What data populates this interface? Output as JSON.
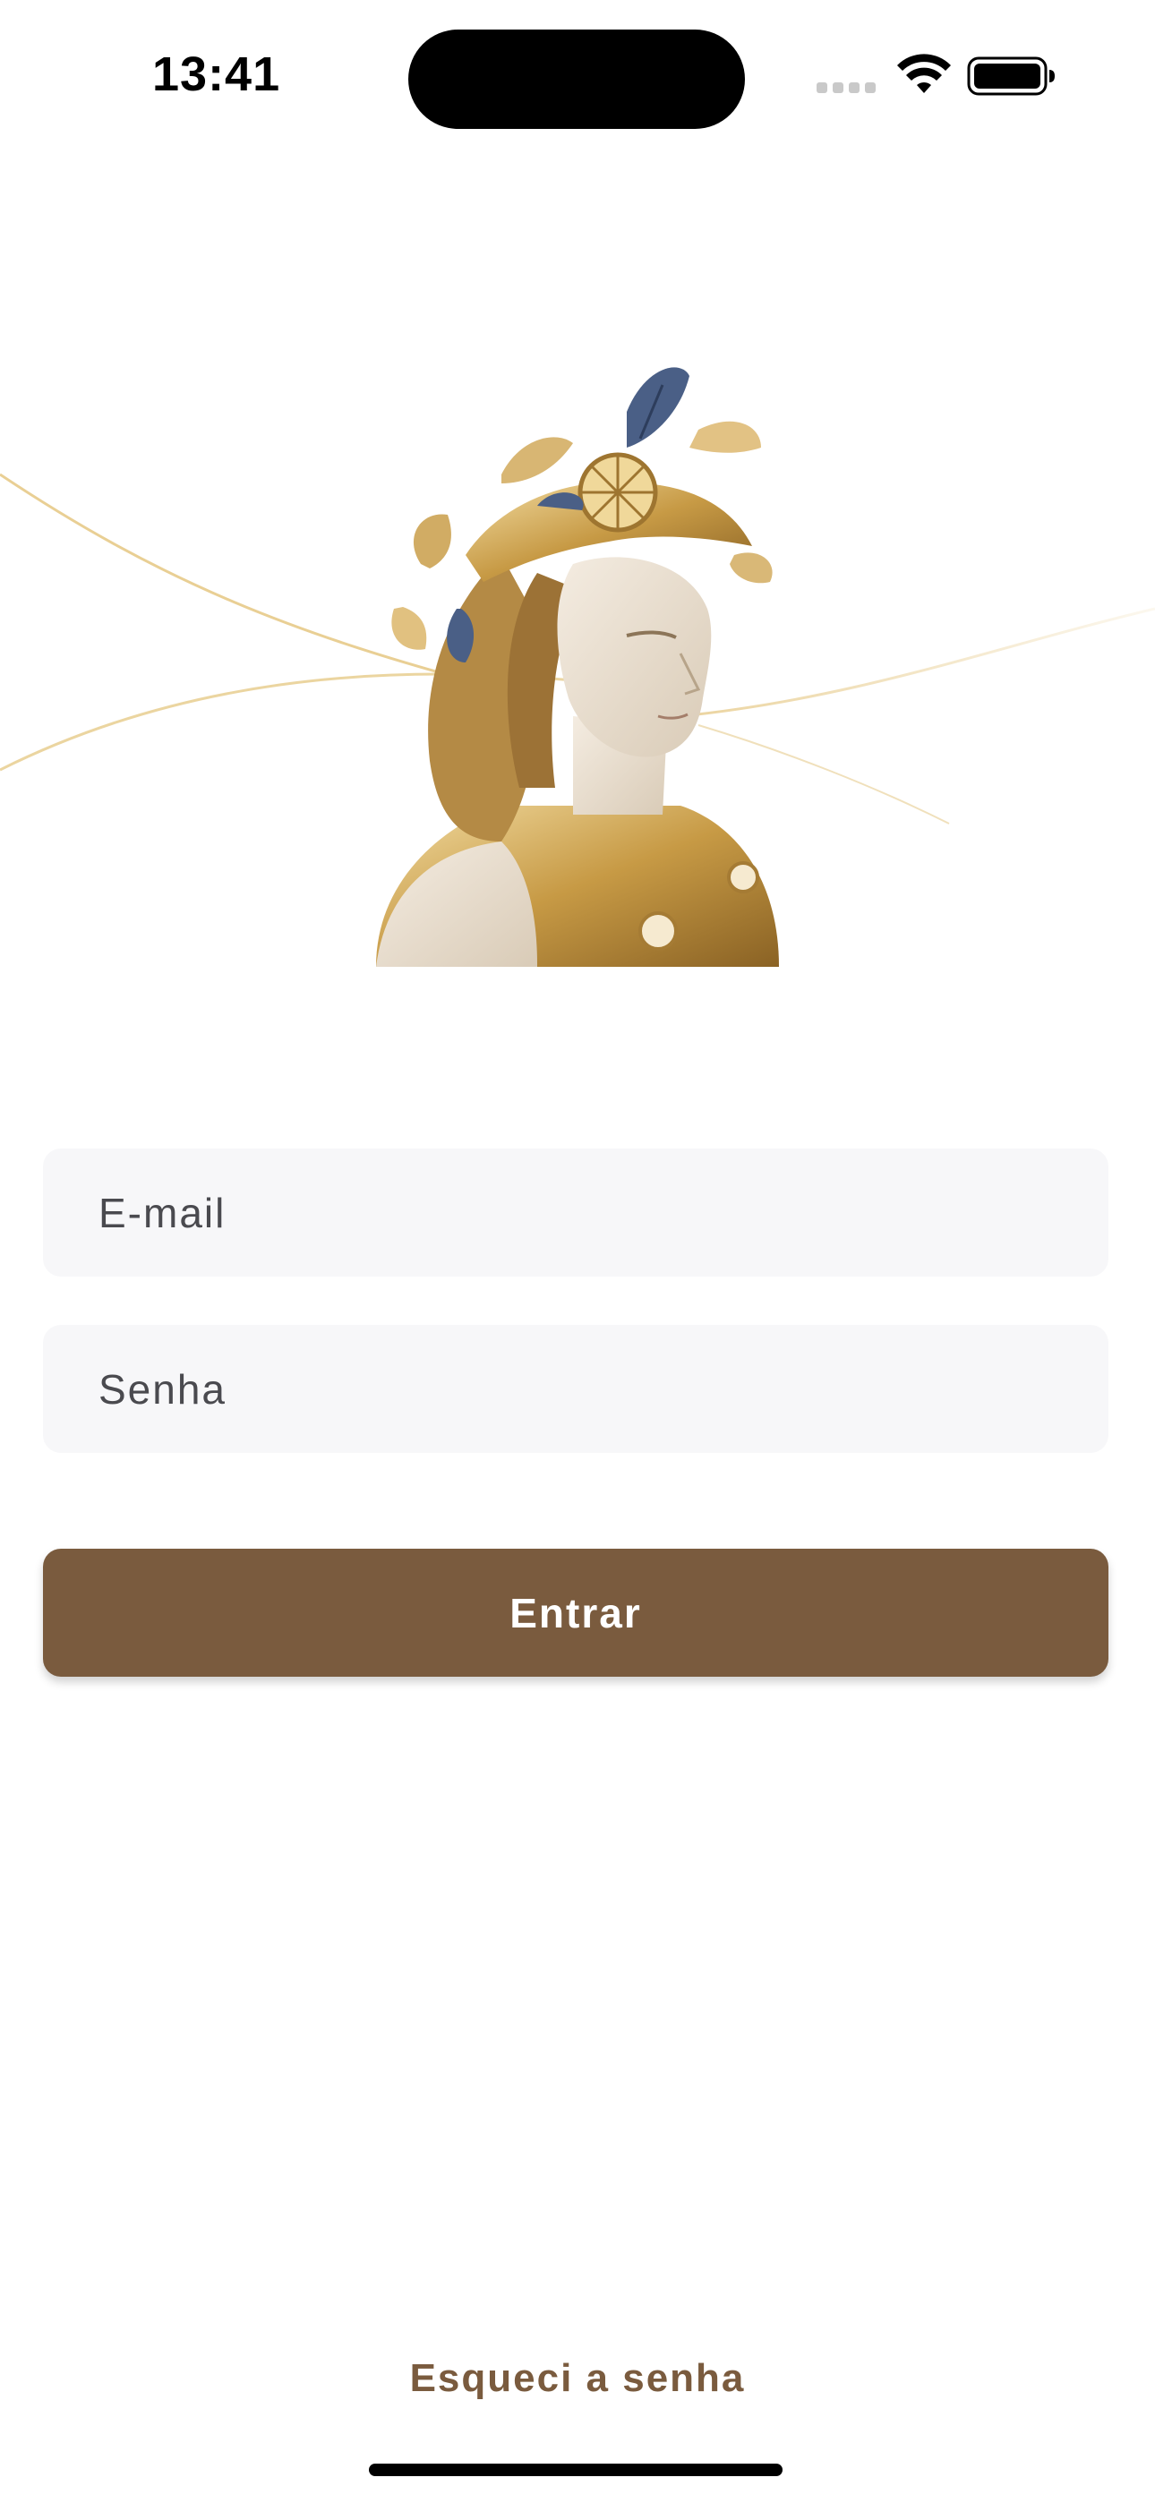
{
  "status_bar": {
    "time": "13:41",
    "icons": [
      "signal-icon",
      "wifi-icon",
      "battery-icon"
    ]
  },
  "hero": {
    "image": "athena-bust-illustration"
  },
  "form": {
    "email_placeholder": "E-mail",
    "password_placeholder": "Senha",
    "submit_label": "Entrar"
  },
  "footer": {
    "forgot_password_label": "Esqueci a senha"
  },
  "colors": {
    "accent": "#7a5b3e",
    "field_background": "#f7f7f9",
    "decor_line": "#e9cf94"
  }
}
